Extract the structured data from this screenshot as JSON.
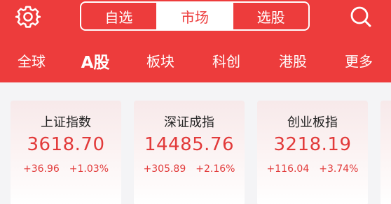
{
  "header": {
    "settings_icon": "gear-icon",
    "search_icon": "search-icon",
    "tabs": [
      {
        "label": "自选",
        "active": false
      },
      {
        "label": "市场",
        "active": true
      },
      {
        "label": "选股",
        "active": false
      }
    ],
    "background_color": "#ed3c3c"
  },
  "subnav": {
    "items": [
      {
        "label": "全球",
        "active": false
      },
      {
        "label": "A股",
        "active": true
      },
      {
        "label": "板块",
        "active": false
      },
      {
        "label": "科创",
        "active": false
      },
      {
        "label": "港股",
        "active": false
      },
      {
        "label": "更多",
        "active": false
      }
    ]
  },
  "indices": [
    {
      "name": "上证指数",
      "value": "3618.70",
      "change": "+36.96",
      "change_pct": "+1.03%"
    },
    {
      "name": "深证成指",
      "value": "14485.76",
      "change": "+305.89",
      "change_pct": "+2.16%"
    },
    {
      "name": "创业板指",
      "value": "3218.19",
      "change": "+116.04",
      "change_pct": "+3.74%"
    }
  ],
  "colors": {
    "up": "#e23a3a",
    "accent": "#ed3c3c"
  }
}
